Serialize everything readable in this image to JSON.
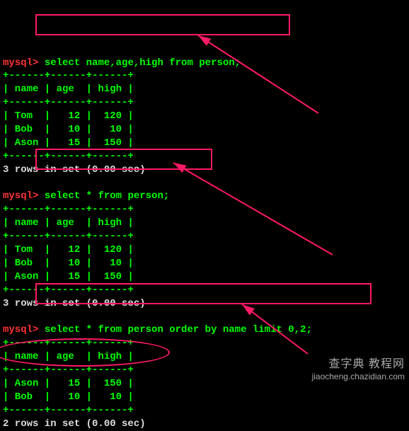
{
  "chart_data": {
    "type": "table",
    "queries": [
      {
        "sql": "select name,age,high from person;",
        "columns": [
          "name",
          "age",
          "high"
        ],
        "rows": [
          {
            "name": "Tom",
            "age": 12,
            "high": 120
          },
          {
            "name": "Bob",
            "age": 10,
            "high": 10
          },
          {
            "name": "Ason",
            "age": 15,
            "high": 150
          }
        ],
        "status": "3 rows in set (0.00 sec)"
      },
      {
        "sql": "select * from person;",
        "columns": [
          "name",
          "age",
          "high"
        ],
        "rows": [
          {
            "name": "Tom",
            "age": 12,
            "high": 120
          },
          {
            "name": "Bob",
            "age": 10,
            "high": 10
          },
          {
            "name": "Ason",
            "age": 15,
            "high": 150
          }
        ],
        "status": "3 rows in set (0.00 sec)"
      },
      {
        "sql": "select * from person order by name limit 0,2;",
        "columns": [
          "name",
          "age",
          "high"
        ],
        "rows": [
          {
            "name": "Ason",
            "age": 15,
            "high": 150
          },
          {
            "name": "Bob",
            "age": 10,
            "high": 10
          }
        ],
        "status": "2 rows in set (0.00 sec)"
      }
    ]
  },
  "prompt": "mysql>",
  "top_status_fragment": "",
  "q1": {
    "cmd": "select name,age,high from person;",
    "sep": "+------+------+------+",
    "hdr": "| name | age  | high |",
    "r1": "| Tom  |   12 |  120 |",
    "r2": "| Bob  |   10 |   10 |",
    "r3": "| Ason |   15 |  150 |",
    "status": "3 rows in set (0.00 sec)"
  },
  "q2": {
    "cmd": "select * from person;",
    "sep": "+------+------+------+",
    "hdr": "| name | age  | high |",
    "r1": "| Tom  |   12 |  120 |",
    "r2": "| Bob  |   10 |   10 |",
    "r3": "| Ason |   15 |  150 |",
    "status": "3 rows in set (0.00 sec)"
  },
  "q3": {
    "cmd": "select * from person order by name limit 0,2;",
    "sep": "+------+------+------+",
    "hdr": "| name | age  | high |",
    "r1": "| Ason |   15 |  150 |",
    "r2": "| Bob  |   10 |   10 |",
    "status": "2 rows in set (0.00 sec)"
  },
  "watermark": {
    "line1": "查字典 教程网",
    "line2": "jiaocheng.chazidian.com"
  },
  "colors": {
    "bg": "#000000",
    "text": "#00ff00",
    "prompt": "#ff3333",
    "status": "#dddddd",
    "annotation": "#ff1a66"
  }
}
